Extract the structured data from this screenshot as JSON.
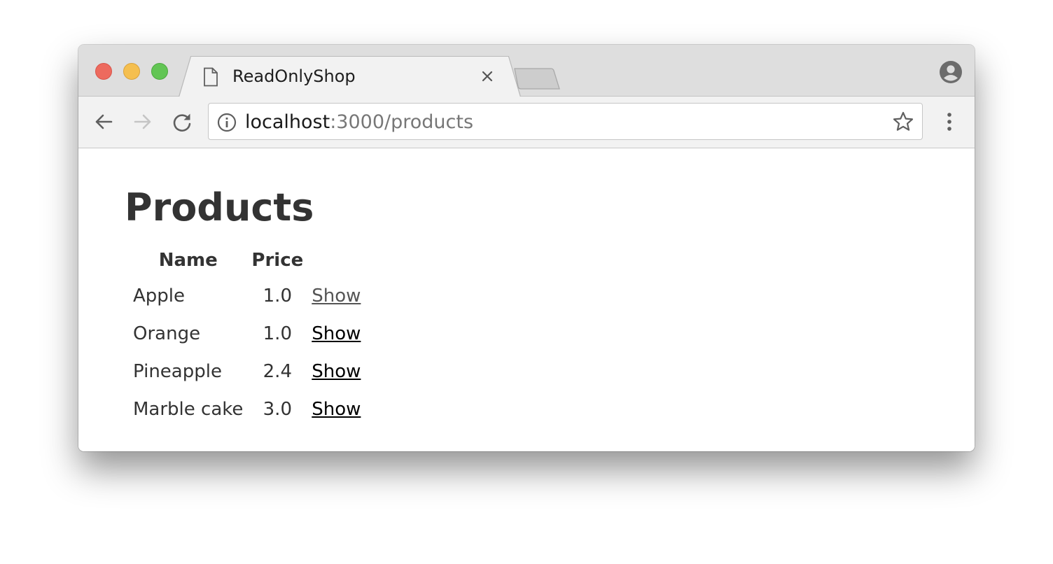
{
  "browser": {
    "tab_title": "ReadOnlyShop",
    "url_host": "localhost",
    "url_rest": ":3000/products"
  },
  "icons": {
    "traffic_lights": [
      "close",
      "minimize",
      "zoom"
    ],
    "tab": "document-icon",
    "tab_close": "close-icon",
    "profile": "account-icon",
    "back": "back-arrow-icon",
    "forward": "forward-arrow-icon",
    "reload": "reload-icon",
    "info": "info-icon",
    "bookmark": "star-icon",
    "menu": "vertical-dots-icon"
  },
  "colors": {
    "traffic_red": "#ed6a5e",
    "traffic_yellow": "#f5bf4f",
    "traffic_green": "#62c554",
    "page_text": "#333333",
    "link": "#000000",
    "visited_link": "#555555"
  },
  "page": {
    "title": "Products",
    "columns": [
      "Name",
      "Price",
      ""
    ],
    "rows": [
      {
        "name": "Apple",
        "price": "1.0",
        "action": "Show"
      },
      {
        "name": "Orange",
        "price": "1.0",
        "action": "Show"
      },
      {
        "name": "Pineapple",
        "price": "2.4",
        "action": "Show"
      },
      {
        "name": "Marble cake",
        "price": "3.0",
        "action": "Show"
      }
    ]
  }
}
